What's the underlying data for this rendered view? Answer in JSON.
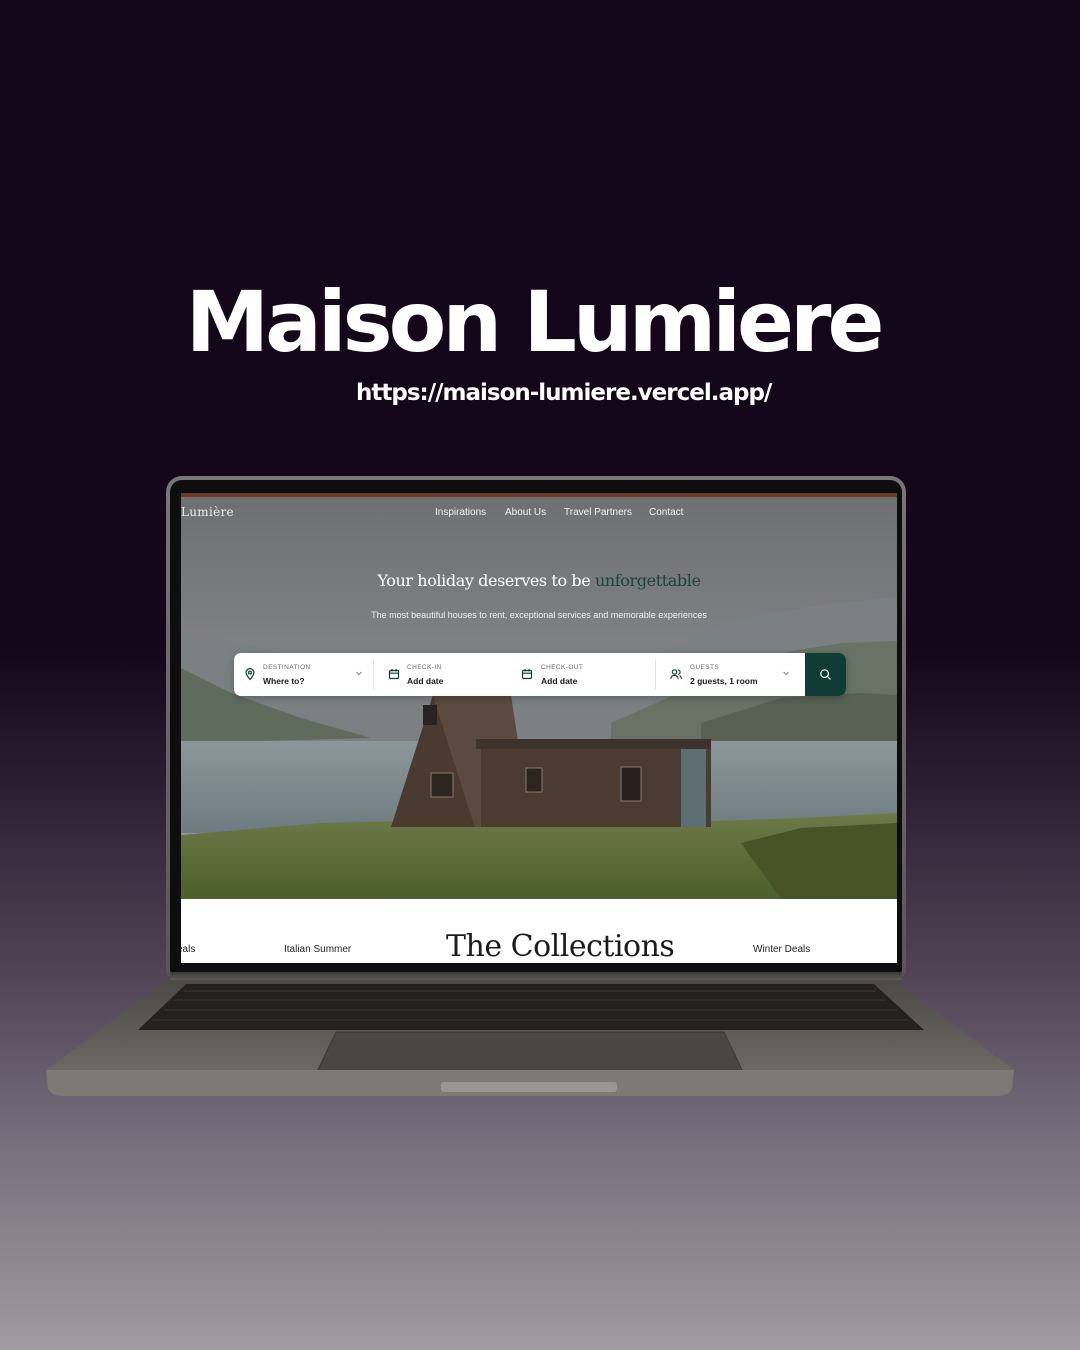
{
  "promo": {
    "title": "Maison Lumiere",
    "url": "https://maison-lumiere.vercel.app/"
  },
  "site": {
    "logo": "Lumière",
    "nav": [
      "Inspirations",
      "About Us",
      "Travel Partners",
      "Contact"
    ],
    "hero": {
      "headline_prefix": "Your holiday deserves to be",
      "headline_accent": "unforgettable",
      "subtitle": "The most beautiful houses to rent, exceptional services and memorable experiences"
    },
    "search": {
      "destination": {
        "label": "DESTINATION",
        "value": "Where to?",
        "icon": "map-pin-icon"
      },
      "checkin": {
        "label": "CHECK-IN",
        "value": "Add date",
        "icon": "calendar-icon"
      },
      "checkout": {
        "label": "CHECK-OUT",
        "value": "Add date",
        "icon": "calendar-icon"
      },
      "guests": {
        "label": "GUESTS",
        "value": "2 guests, 1 room",
        "icon": "users-icon"
      },
      "button_icon": "search-icon"
    },
    "collections": {
      "title": "The Collections",
      "items": [
        "eals",
        "Italian Summer",
        "Winter Deals"
      ]
    }
  },
  "colors": {
    "background_top": "#14071a",
    "background_bottom": "#a09aa2",
    "accent_green": "#0f3d36",
    "headline_accent": "#17453e",
    "hero_topline": "#6b3a2a"
  }
}
